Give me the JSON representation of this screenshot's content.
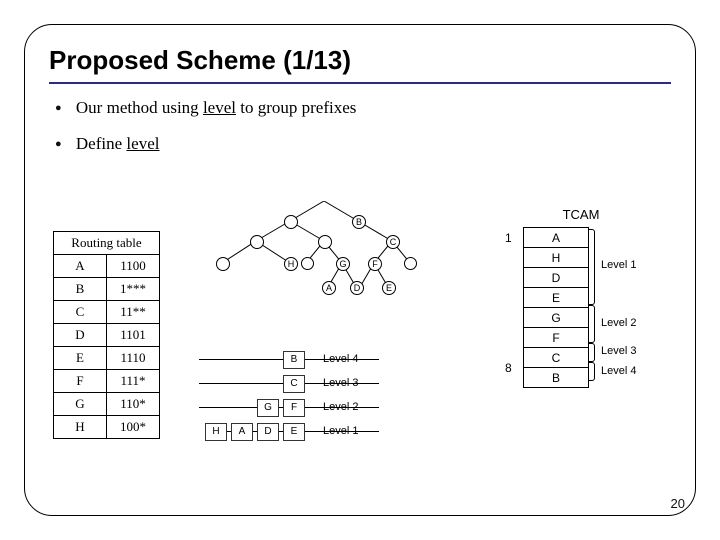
{
  "title": "Proposed Scheme (1/13)",
  "bullets": {
    "b1a": "Our method using ",
    "b1u": "level",
    "b1b": " to group prefixes",
    "b2a": "Define ",
    "b2u": "level"
  },
  "routing": {
    "header": "Routing table",
    "rows": [
      {
        "k": "A",
        "v": "1100"
      },
      {
        "k": "B",
        "v": "1***"
      },
      {
        "k": "C",
        "v": "11**"
      },
      {
        "k": "D",
        "v": "1101"
      },
      {
        "k": "E",
        "v": "1110"
      },
      {
        "k": "F",
        "v": "111*"
      },
      {
        "k": "G",
        "v": "110*"
      },
      {
        "k": "H",
        "v": "100*"
      }
    ]
  },
  "tree": {
    "labels": {
      "B": "B",
      "C": "C",
      "H": "H",
      "G": "G",
      "F": "F",
      "A": "A",
      "D": "D",
      "E": "E"
    }
  },
  "stack": {
    "rows": [
      {
        "cells": [
          "B"
        ],
        "label": "Level 4"
      },
      {
        "cells": [
          "C"
        ],
        "label": "Level 3"
      },
      {
        "cells": [
          "G",
          "F"
        ],
        "label": "Level 2"
      },
      {
        "cells": [
          "H",
          "A",
          "D",
          "E"
        ],
        "label": "Level 1"
      }
    ]
  },
  "tcam": {
    "title": "TCAM",
    "left_nums": {
      "one": "1",
      "eight": "8"
    },
    "cells": [
      "A",
      "H",
      "D",
      "E",
      "G",
      "F",
      "C",
      "B"
    ],
    "labels": {
      "l1": "Level 1",
      "l2": "Level 2",
      "l3": "Level 3",
      "l4": "Level 4"
    }
  },
  "pagenum": "20"
}
